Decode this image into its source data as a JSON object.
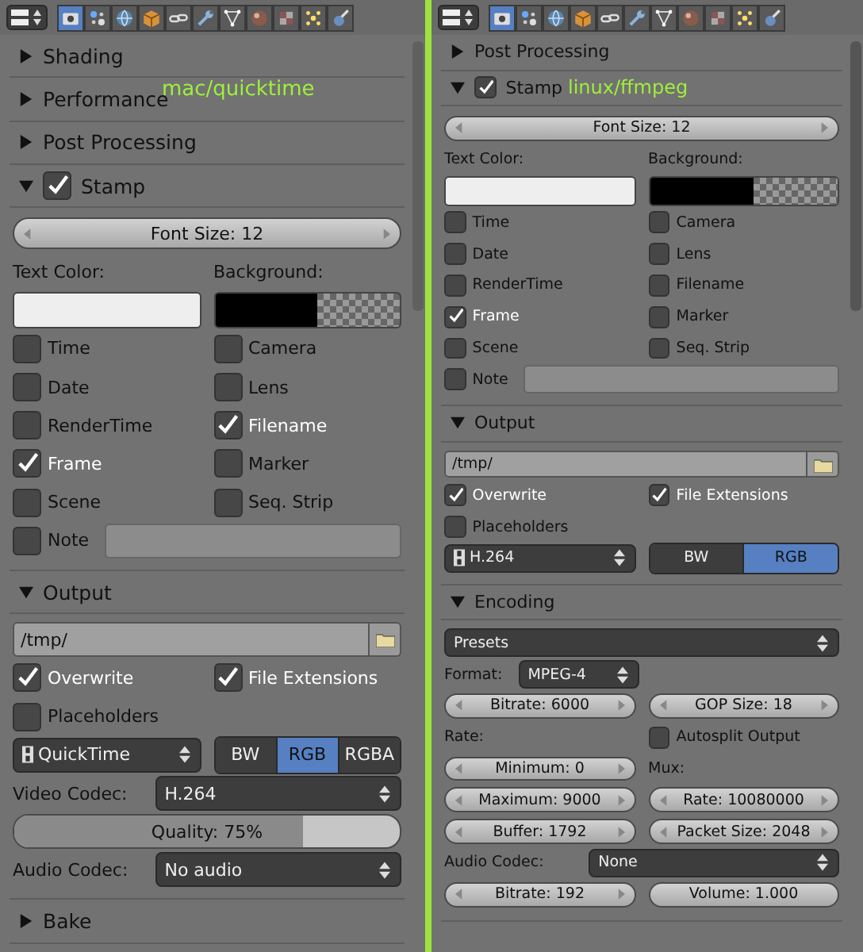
{
  "panes": [
    {
      "label": "mac/quicktime",
      "context_tabs": [
        {
          "selected": true
        },
        {
          "selected": false
        },
        {
          "selected": false
        },
        {
          "selected": false
        },
        {
          "selected": false
        },
        {
          "selected": false
        },
        {
          "selected": false
        },
        {
          "selected": false
        },
        {
          "selected": false
        },
        {
          "selected": false
        },
        {
          "selected": false
        }
      ],
      "panels": [
        {
          "title": "Shading",
          "expanded": false
        },
        {
          "title": "Performance",
          "expanded": false
        },
        {
          "title": "Post Processing",
          "expanded": false
        },
        {
          "title": "Stamp",
          "expanded": true,
          "enabled": true,
          "rows": [
            {
              "kind": "split",
              "cells": [
                {
                  "kind": "number",
                  "text": "Font Size: 12"
                }
              ]
            },
            {
              "kind": "split",
              "cells": [
                {
                  "kind": "label",
                  "text": "Text Color:"
                },
                {
                  "kind": "label",
                  "text": "Background:"
                }
              ]
            },
            {
              "kind": "split",
              "cells": [
                {
                  "kind": "color",
                  "color": "#eeeeee",
                  "alpha": false
                },
                {
                  "kind": "color",
                  "color": "#000000",
                  "alpha": true
                }
              ]
            },
            {
              "kind": "split",
              "cells": [
                {
                  "kind": "check",
                  "text": "Time",
                  "checked": false
                },
                {
                  "kind": "check",
                  "text": "Camera",
                  "checked": false
                }
              ]
            },
            {
              "kind": "split",
              "cells": [
                {
                  "kind": "check",
                  "text": "Date",
                  "checked": false
                },
                {
                  "kind": "check",
                  "text": "Lens",
                  "checked": false
                }
              ]
            },
            {
              "kind": "split",
              "cells": [
                {
                  "kind": "check",
                  "text": "RenderTime",
                  "checked": false
                },
                {
                  "kind": "check",
                  "text": "Filename",
                  "checked": true
                }
              ]
            },
            {
              "kind": "split",
              "cells": [
                {
                  "kind": "check",
                  "text": "Frame",
                  "checked": true
                },
                {
                  "kind": "check",
                  "text": "Marker",
                  "checked": false
                }
              ]
            },
            {
              "kind": "split",
              "cells": [
                {
                  "kind": "check",
                  "text": "Scene",
                  "checked": false
                },
                {
                  "kind": "check",
                  "text": "Seq. Strip",
                  "checked": false
                }
              ]
            },
            {
              "kind": "inline",
              "cells": [
                {
                  "kind": "check",
                  "text": "Note",
                  "checked": false
                },
                {
                  "kind": "field"
                }
              ]
            }
          ]
        },
        {
          "title": "Output",
          "expanded": true,
          "rows": [
            {
              "kind": "split",
              "cells": [
                {
                  "kind": "path",
                  "text": "/tmp/"
                }
              ]
            },
            {
              "kind": "split",
              "cells": [
                {
                  "kind": "check",
                  "text": "Overwrite",
                  "checked": true
                },
                {
                  "kind": "check",
                  "text": "File Extensions",
                  "checked": true
                }
              ]
            },
            {
              "kind": "split",
              "cells": [
                {
                  "kind": "check",
                  "text": "Placeholders",
                  "checked": false
                }
              ]
            },
            {
              "kind": "split",
              "cells": [
                {
                  "kind": "menu",
                  "text": "QuickTime",
                  "icon": true
                },
                {
                  "kind": "modes",
                  "options": [
                    {
                      "label": "BW",
                      "selected": false
                    },
                    {
                      "label": "RGB",
                      "selected": true
                    },
                    {
                      "label": "RGBA",
                      "selected": false
                    }
                  ]
                }
              ]
            },
            {
              "kind": "prop",
              "cells": [
                {
                  "kind": "label",
                  "text": "Video Codec:"
                },
                {
                  "kind": "menu",
                  "text": "H.264"
                }
              ]
            },
            {
              "kind": "split",
              "cells": [
                {
                  "kind": "progress",
                  "text": "Quality: 75%",
                  "level": 0.75
                }
              ]
            },
            {
              "kind": "prop",
              "cells": [
                {
                  "kind": "label",
                  "text": "Audio Codec:"
                },
                {
                  "kind": "menu",
                  "text": "No audio"
                }
              ]
            }
          ]
        },
        {
          "title": "Bake",
          "expanded": false
        }
      ]
    },
    {
      "label": "linux/ffmpeg",
      "context_tabs": [
        {
          "selected": true
        },
        {
          "selected": false
        },
        {
          "selected": false
        },
        {
          "selected": false
        },
        {
          "selected": false
        },
        {
          "selected": false
        },
        {
          "selected": false
        },
        {
          "selected": false
        },
        {
          "selected": false
        },
        {
          "selected": false
        },
        {
          "selected": false
        }
      ],
      "panels": [
        {
          "title": "Post Processing",
          "expanded": false
        },
        {
          "title": "Stamp",
          "expanded": true,
          "enabled": true,
          "rows": [
            {
              "kind": "split",
              "cells": [
                {
                  "kind": "number",
                  "text": "Font Size: 12"
                }
              ]
            },
            {
              "kind": "split",
              "cells": [
                {
                  "kind": "label",
                  "text": "Text Color:"
                },
                {
                  "kind": "label",
                  "text": "Background:"
                }
              ]
            },
            {
              "kind": "split",
              "cells": [
                {
                  "kind": "color",
                  "color": "#eeeeee",
                  "alpha": false
                },
                {
                  "kind": "color",
                  "color": "#000000",
                  "alpha": true
                }
              ]
            },
            {
              "kind": "split",
              "cells": [
                {
                  "kind": "check",
                  "text": "Time",
                  "checked": false
                },
                {
                  "kind": "check",
                  "text": "Camera",
                  "checked": false
                }
              ]
            },
            {
              "kind": "split",
              "cells": [
                {
                  "kind": "check",
                  "text": "Date",
                  "checked": false
                },
                {
                  "kind": "check",
                  "text": "Lens",
                  "checked": false
                }
              ]
            },
            {
              "kind": "split",
              "cells": [
                {
                  "kind": "check",
                  "text": "RenderTime",
                  "checked": false
                },
                {
                  "kind": "check",
                  "text": "Filename",
                  "checked": false
                }
              ]
            },
            {
              "kind": "split",
              "cells": [
                {
                  "kind": "check",
                  "text": "Frame",
                  "checked": true
                },
                {
                  "kind": "check",
                  "text": "Marker",
                  "checked": false
                }
              ]
            },
            {
              "kind": "split",
              "cells": [
                {
                  "kind": "check",
                  "text": "Scene",
                  "checked": false
                },
                {
                  "kind": "check",
                  "text": "Seq. Strip",
                  "checked": false
                }
              ]
            },
            {
              "kind": "inline",
              "cells": [
                {
                  "kind": "check",
                  "text": "Note",
                  "checked": false
                },
                {
                  "kind": "field"
                }
              ]
            }
          ]
        },
        {
          "title": "Output",
          "expanded": true,
          "rows": [
            {
              "kind": "split",
              "cells": [
                {
                  "kind": "path",
                  "text": "/tmp/"
                }
              ]
            },
            {
              "kind": "split",
              "cells": [
                {
                  "kind": "check",
                  "text": "Overwrite",
                  "checked": true
                },
                {
                  "kind": "check",
                  "text": "File Extensions",
                  "checked": true
                }
              ]
            },
            {
              "kind": "split",
              "cells": [
                {
                  "kind": "check",
                  "text": "Placeholders",
                  "checked": false
                }
              ]
            },
            {
              "kind": "split",
              "cells": [
                {
                  "kind": "menu",
                  "text": "H.264",
                  "icon": true
                },
                {
                  "kind": "modes",
                  "options": [
                    {
                      "label": "BW",
                      "selected": false
                    },
                    {
                      "label": "RGB",
                      "selected": true
                    }
                  ]
                }
              ]
            }
          ]
        },
        {
          "title": "Encoding",
          "expanded": true,
          "rows": [
            {
              "kind": "split",
              "cells": [
                {
                  "kind": "menu",
                  "text": "Presets"
                }
              ]
            },
            {
              "kind": "split",
              "cells": [
                {
                  "kind": "menu",
                  "label": "Format:",
                  "text": "MPEG-4"
                },
                ""
              ]
            },
            {
              "kind": "split",
              "cells": [
                {
                  "kind": "number",
                  "text": "Bitrate: 6000"
                },
                {
                  "kind": "number",
                  "text": "GOP Size: 18"
                }
              ]
            },
            {
              "kind": "split",
              "cells": [
                {
                  "kind": "label",
                  "text": "Rate:"
                },
                {
                  "kind": "check",
                  "text": "Autosplit Output",
                  "checked": false
                }
              ]
            },
            {
              "kind": "split",
              "cells": [
                {
                  "kind": "number",
                  "text": "Minimum: 0"
                },
                {
                  "kind": "label",
                  "text": "Mux:"
                }
              ]
            },
            {
              "kind": "split",
              "cells": [
                {
                  "kind": "number",
                  "text": "Maximum: 9000"
                },
                {
                  "kind": "number",
                  "text": "Rate: 10080000"
                }
              ]
            },
            {
              "kind": "split",
              "cells": [
                {
                  "kind": "number",
                  "text": "Buffer: 1792"
                },
                {
                  "kind": "number",
                  "text": "Packet Size: 2048"
                }
              ]
            },
            {
              "kind": "prop",
              "cells": [
                {
                  "kind": "label",
                  "text": "Audio Codec:"
                },
                {
                  "kind": "menu",
                  "text": "None"
                }
              ]
            },
            {
              "kind": "split",
              "cells": [
                {
                  "kind": "number",
                  "text": "Bitrate: 192"
                },
                {
                  "kind": "slider",
                  "text": "Volume: 1.000"
                }
              ]
            }
          ]
        }
      ]
    }
  ]
}
